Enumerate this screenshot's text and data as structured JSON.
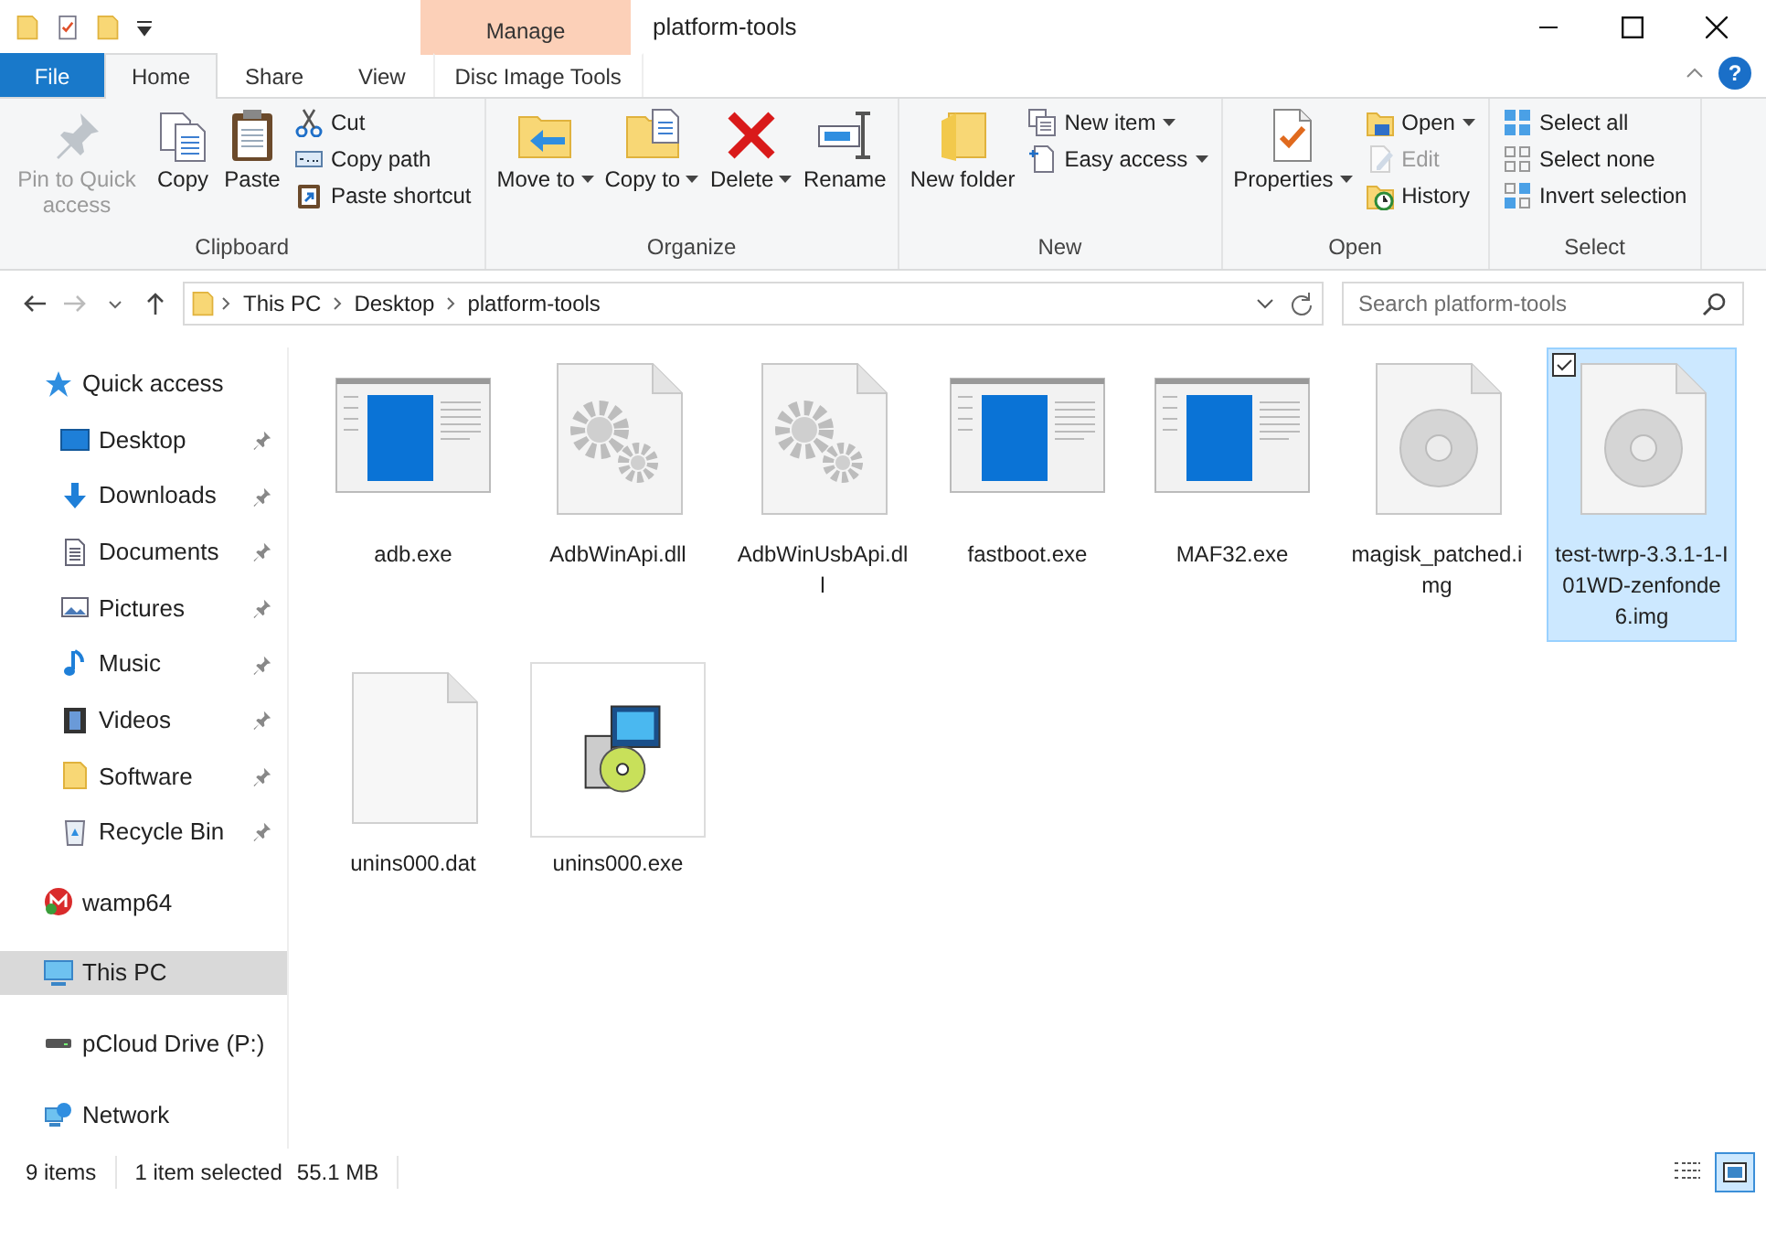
{
  "window": {
    "title": "platform-tools",
    "context_group": "Manage"
  },
  "tabs": [
    {
      "label": "File",
      "kind": "file",
      "selected": false
    },
    {
      "label": "Home",
      "kind": "normal",
      "selected": true
    },
    {
      "label": "Share",
      "kind": "normal",
      "selected": false
    },
    {
      "label": "View",
      "kind": "normal",
      "selected": false
    },
    {
      "label": "Disc Image Tools",
      "kind": "contextual",
      "selected": false
    }
  ],
  "help": "?",
  "ribbon": {
    "groups": [
      {
        "label": "Clipboard",
        "items": [
          {
            "label": "Pin to Quick access",
            "kind": "pin",
            "disabled": true,
            "dropdown": false
          },
          {
            "label": "Copy",
            "kind": "copy",
            "disabled": false,
            "dropdown": false
          },
          {
            "label": "Paste",
            "kind": "paste",
            "disabled": false,
            "dropdown": false
          },
          {
            "label": "Cut",
            "kind": "cut",
            "disabled": false,
            "dropdown": false
          },
          {
            "label": "Copy path",
            "kind": "copy_path",
            "disabled": false,
            "dropdown": false
          },
          {
            "label": "Paste shortcut",
            "kind": "paste_shortcut",
            "disabled": false,
            "dropdown": false
          }
        ]
      },
      {
        "label": "Organize",
        "items": [
          {
            "label": "Move to",
            "kind": "move",
            "disabled": false,
            "dropdown": true
          },
          {
            "label": "Copy to",
            "kind": "copy_to",
            "disabled": false,
            "dropdown": true
          },
          {
            "label": "Delete",
            "kind": "delete",
            "disabled": false,
            "dropdown": true
          },
          {
            "label": "Rename",
            "kind": "rename",
            "disabled": false,
            "dropdown": false
          }
        ]
      },
      {
        "label": "New",
        "items": [
          {
            "label": "New folder",
            "kind": "new_folder",
            "disabled": false,
            "dropdown": false
          },
          {
            "label": "New item",
            "kind": "new_item",
            "disabled": false,
            "dropdown": true
          },
          {
            "label": "Easy access",
            "kind": "easy_access",
            "disabled": false,
            "dropdown": true
          }
        ]
      },
      {
        "label": "Open",
        "items": [
          {
            "label": "Properties",
            "kind": "properties",
            "disabled": false,
            "dropdown": true
          },
          {
            "label": "Open",
            "kind": "open",
            "disabled": false,
            "dropdown": true
          },
          {
            "label": "Edit",
            "kind": "edit",
            "disabled": true,
            "dropdown": false
          },
          {
            "label": "History",
            "kind": "history",
            "disabled": false,
            "dropdown": false
          }
        ]
      },
      {
        "label": "Select",
        "items": [
          {
            "label": "Select all",
            "kind": "select_all",
            "disabled": false,
            "dropdown": false
          },
          {
            "label": "Select none",
            "kind": "select_none",
            "disabled": false,
            "dropdown": false
          },
          {
            "label": "Invert selection",
            "kind": "invert",
            "disabled": false,
            "dropdown": false
          }
        ]
      }
    ]
  },
  "address_bar": {
    "breadcrumbs": [
      "This PC",
      "Desktop",
      "platform-tools"
    ],
    "forward_disabled": true
  },
  "search": {
    "placeholder": "Search platform-tools"
  },
  "navigation": {
    "items": [
      {
        "label": "Quick access",
        "kind": "star",
        "selected": false,
        "children": [
          {
            "label": "Desktop",
            "kind": "desktop",
            "pinned": true,
            "selected": false
          },
          {
            "label": "Downloads",
            "kind": "downloads",
            "pinned": true,
            "selected": false
          },
          {
            "label": "Documents",
            "kind": "documents",
            "pinned": true,
            "selected": false
          },
          {
            "label": "Pictures",
            "kind": "pictures",
            "pinned": true,
            "selected": false
          },
          {
            "label": "Music",
            "kind": "music",
            "pinned": true,
            "selected": false
          },
          {
            "label": "Videos",
            "kind": "videos",
            "pinned": true,
            "selected": false
          },
          {
            "label": "Software",
            "kind": "folder",
            "pinned": true,
            "selected": false
          },
          {
            "label": "Recycle Bin",
            "kind": "recycle",
            "pinned": true,
            "selected": false
          }
        ]
      },
      {
        "label": "wamp64",
        "kind": "wamp",
        "selected": false
      },
      {
        "label": "This PC",
        "kind": "pc",
        "selected": true
      },
      {
        "label": "pCloud Drive (P:)",
        "kind": "drive",
        "selected": false
      },
      {
        "label": "Network",
        "kind": "network",
        "selected": false
      }
    ]
  },
  "files": [
    {
      "name": "adb.exe",
      "kind": "exe",
      "selected": false
    },
    {
      "name": "AdbWinApi.dll",
      "kind": "dll",
      "selected": false
    },
    {
      "name": "AdbWinUsbApi.dll",
      "kind": "dll",
      "selected": false
    },
    {
      "name": "fastboot.exe",
      "kind": "exe",
      "selected": false
    },
    {
      "name": "MAF32.exe",
      "kind": "exe",
      "selected": false
    },
    {
      "name": "magisk_patched.img",
      "kind": "img",
      "selected": false
    },
    {
      "name": "test-twrp-3.3.1-1-I01WD-zenfonde6.img",
      "kind": "img",
      "selected": true
    },
    {
      "name": "unins000.dat",
      "kind": "dat",
      "selected": false
    },
    {
      "name": "unins000.exe",
      "kind": "setup",
      "selected": false
    }
  ],
  "status_bar": {
    "item_count": "9 items",
    "selection": "1 item selected",
    "size": "55.1 MB",
    "views": [
      {
        "kind": "details",
        "selected": false
      },
      {
        "kind": "large_icons",
        "selected": true
      }
    ]
  }
}
